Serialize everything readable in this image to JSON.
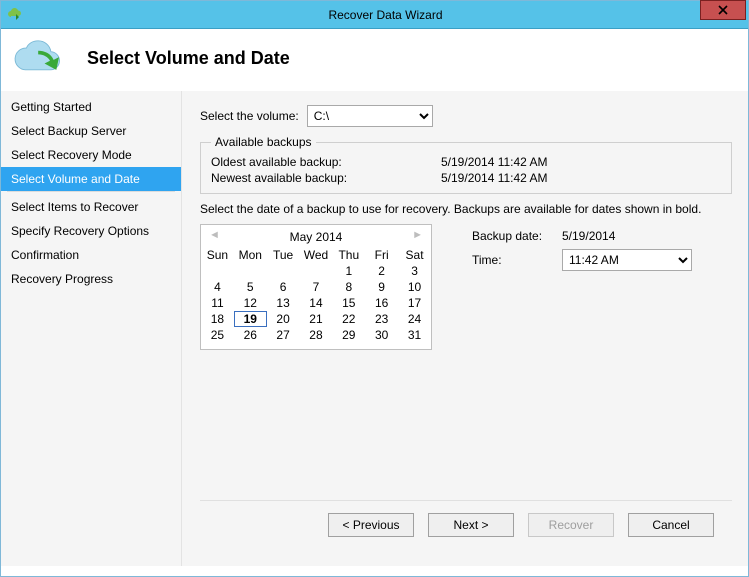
{
  "window": {
    "title": "Recover Data Wizard"
  },
  "header": {
    "title": "Select Volume and Date"
  },
  "sidebar": {
    "items": [
      {
        "label": "Getting Started"
      },
      {
        "label": "Select Backup Server"
      },
      {
        "label": "Select Recovery Mode"
      },
      {
        "label": "Select Volume and Date"
      },
      {
        "label": "Select Items to Recover"
      },
      {
        "label": "Specify Recovery Options"
      },
      {
        "label": "Confirmation"
      },
      {
        "label": "Recovery Progress"
      }
    ]
  },
  "main": {
    "volume_label": "Select the volume:",
    "volume_value": "C:\\",
    "available": {
      "legend": "Available backups",
      "oldest_label": "Oldest available backup:",
      "oldest_value": "5/19/2014 11:42 AM",
      "newest_label": "Newest available backup:",
      "newest_value": "5/19/2014 11:42 AM"
    },
    "instruction": "Select the date of a backup to use for recovery. Backups are available for dates shown in bold.",
    "calendar": {
      "month_label": "May 2014",
      "prev": "◄",
      "next": "►",
      "days": [
        "Sun",
        "Mon",
        "Tue",
        "Wed",
        "Thu",
        "Fri",
        "Sat"
      ],
      "weeks": [
        [
          "",
          "",
          "",
          "",
          "1",
          "2",
          "3"
        ],
        [
          "4",
          "5",
          "6",
          "7",
          "8",
          "9",
          "10"
        ],
        [
          "11",
          "12",
          "13",
          "14",
          "15",
          "16",
          "17"
        ],
        [
          "18",
          "19",
          "20",
          "21",
          "22",
          "23",
          "24"
        ],
        [
          "25",
          "26",
          "27",
          "28",
          "29",
          "30",
          "31"
        ]
      ],
      "selected": "19"
    },
    "backup": {
      "date_label": "Backup date:",
      "date_value": "5/19/2014",
      "time_label": "Time:",
      "time_value": "11:42 AM"
    }
  },
  "footer": {
    "previous": "< Previous",
    "next": "Next >",
    "recover": "Recover",
    "cancel": "Cancel"
  }
}
